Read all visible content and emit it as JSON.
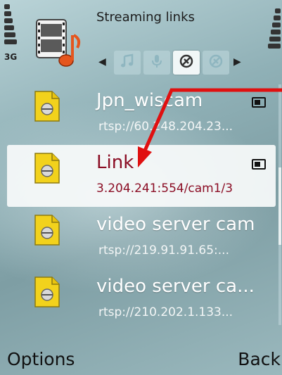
{
  "status": {
    "network": "3G"
  },
  "header": {
    "title": "Streaming links"
  },
  "tabs": [
    {
      "name": "music-icon",
      "active": false
    },
    {
      "name": "microphone-icon",
      "active": false
    },
    {
      "name": "streaming-link-icon",
      "active": true
    },
    {
      "name": "streaming-link-alt-icon",
      "active": false
    }
  ],
  "items": [
    {
      "title": "Jpn_wiscam",
      "url": "rtsp://60.248.204.23...",
      "selected": false
    },
    {
      "title": "Link",
      "url": "3.204.241:554/cam1/3",
      "selected": true
    },
    {
      "title": "video server cam",
      "url": "rtsp://219.91.91.65:...",
      "selected": false
    },
    {
      "title": "video server ca...",
      "url": "rtsp://210.202.1.133...",
      "selected": false
    }
  ],
  "softkeys": {
    "left": "Options",
    "right": "Back"
  },
  "colors": {
    "selected_text": "#8b0d24",
    "annotation": "#e01010",
    "icon_yellow": "#f2d21c"
  }
}
